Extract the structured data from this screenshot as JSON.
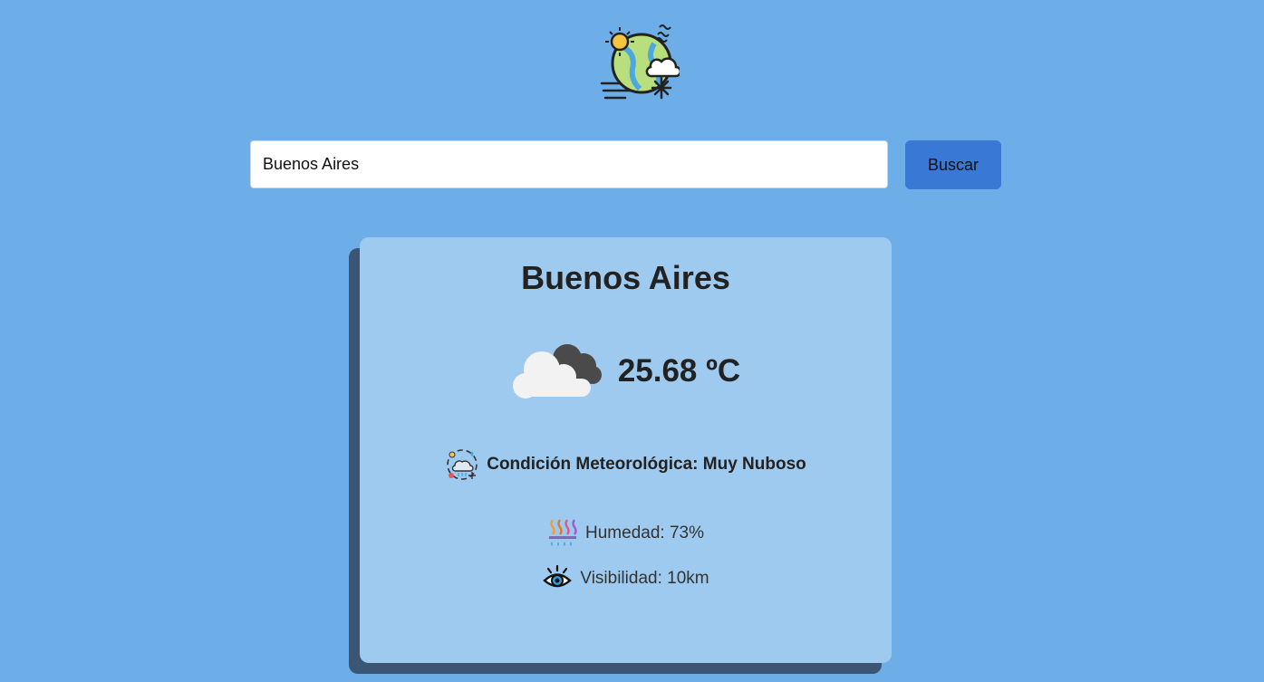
{
  "icons": {
    "logo": "weather-globe-icon",
    "weather": "cloudy-icon",
    "condition": "weather-condition-icon",
    "humidity": "humidity-icon",
    "visibility": "eye-icon"
  },
  "search": {
    "value": "Buenos Aires",
    "button_label": "Buscar"
  },
  "weather": {
    "city": "Buenos Aires",
    "temperature": "25.68 ºC",
    "condition": "Condición Meteorológica: Muy Nuboso",
    "humidity": "Humedad: 73%",
    "visibility": "Visibilidad: 10km"
  },
  "colors": {
    "background": "#6eaee8",
    "card": "#9fcaef",
    "card_shadow": "#3b5675",
    "button": "#3a78d6"
  }
}
